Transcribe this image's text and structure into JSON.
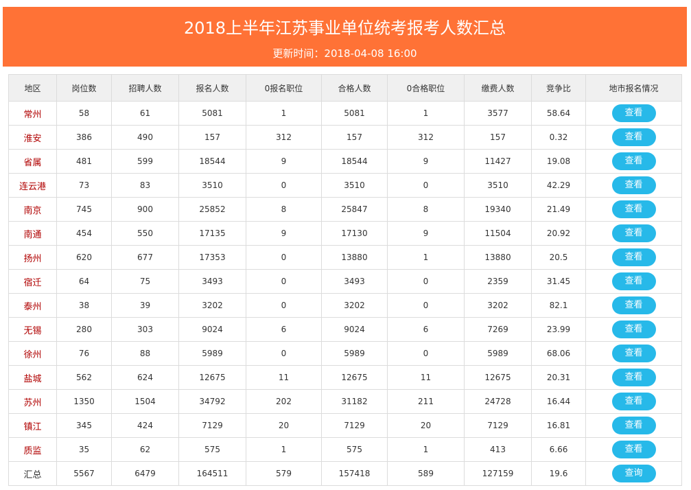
{
  "header": {
    "title": "2018上半年江苏事业单位统考报考人数汇总",
    "subtitle": "更新时间：2018-04-08 16:00"
  },
  "table": {
    "columns": [
      "地区",
      "岗位数",
      "招聘人数",
      "报名人数",
      "0报名职位",
      "合格人数",
      "0合格职位",
      "缴费人数",
      "竞争比",
      "地市报名情况"
    ],
    "rows": [
      {
        "region": "常州",
        "posts": "58",
        "hires": "61",
        "applicants": "5081",
        "zero_apply": "1",
        "qualified": "5081",
        "zero_qualified": "1",
        "paid": "3577",
        "ratio": "58.64",
        "action": "查看"
      },
      {
        "region": "淮安",
        "posts": "386",
        "hires": "490",
        "applicants": "157",
        "zero_apply": "312",
        "qualified": "157",
        "zero_qualified": "312",
        "paid": "157",
        "ratio": "0.32",
        "action": "查看"
      },
      {
        "region": "省属",
        "posts": "481",
        "hires": "599",
        "applicants": "18544",
        "zero_apply": "9",
        "qualified": "18544",
        "zero_qualified": "9",
        "paid": "11427",
        "ratio": "19.08",
        "action": "查看"
      },
      {
        "region": "连云港",
        "posts": "73",
        "hires": "83",
        "applicants": "3510",
        "zero_apply": "0",
        "qualified": "3510",
        "zero_qualified": "0",
        "paid": "3510",
        "ratio": "42.29",
        "action": "查看"
      },
      {
        "region": "南京",
        "posts": "745",
        "hires": "900",
        "applicants": "25852",
        "zero_apply": "8",
        "qualified": "25847",
        "zero_qualified": "8",
        "paid": "19340",
        "ratio": "21.49",
        "action": "查看"
      },
      {
        "region": "南通",
        "posts": "454",
        "hires": "550",
        "applicants": "17135",
        "zero_apply": "9",
        "qualified": "17130",
        "zero_qualified": "9",
        "paid": "11504",
        "ratio": "20.92",
        "action": "查看"
      },
      {
        "region": "扬州",
        "posts": "620",
        "hires": "677",
        "applicants": "17353",
        "zero_apply": "0",
        "qualified": "13880",
        "zero_qualified": "1",
        "paid": "13880",
        "ratio": "20.5",
        "action": "查看"
      },
      {
        "region": "宿迁",
        "posts": "64",
        "hires": "75",
        "applicants": "3493",
        "zero_apply": "0",
        "qualified": "3493",
        "zero_qualified": "0",
        "paid": "2359",
        "ratio": "31.45",
        "action": "查看"
      },
      {
        "region": "泰州",
        "posts": "38",
        "hires": "39",
        "applicants": "3202",
        "zero_apply": "0",
        "qualified": "3202",
        "zero_qualified": "0",
        "paid": "3202",
        "ratio": "82.1",
        "action": "查看"
      },
      {
        "region": "无锡",
        "posts": "280",
        "hires": "303",
        "applicants": "9024",
        "zero_apply": "6",
        "qualified": "9024",
        "zero_qualified": "6",
        "paid": "7269",
        "ratio": "23.99",
        "action": "查看"
      },
      {
        "region": "徐州",
        "posts": "76",
        "hires": "88",
        "applicants": "5989",
        "zero_apply": "0",
        "qualified": "5989",
        "zero_qualified": "0",
        "paid": "5989",
        "ratio": "68.06",
        "action": "查看"
      },
      {
        "region": "盐城",
        "posts": "562",
        "hires": "624",
        "applicants": "12675",
        "zero_apply": "11",
        "qualified": "12675",
        "zero_qualified": "11",
        "paid": "12675",
        "ratio": "20.31",
        "action": "查看"
      },
      {
        "region": "苏州",
        "posts": "1350",
        "hires": "1504",
        "applicants": "34792",
        "zero_apply": "202",
        "qualified": "31182",
        "zero_qualified": "211",
        "paid": "24728",
        "ratio": "16.44",
        "action": "查看"
      },
      {
        "region": "镇江",
        "posts": "345",
        "hires": "424",
        "applicants": "7129",
        "zero_apply": "20",
        "qualified": "7129",
        "zero_qualified": "20",
        "paid": "7129",
        "ratio": "16.81",
        "action": "查看"
      },
      {
        "region": "质监",
        "posts": "35",
        "hires": "62",
        "applicants": "575",
        "zero_apply": "1",
        "qualified": "575",
        "zero_qualified": "1",
        "paid": "413",
        "ratio": "6.66",
        "action": "查看"
      },
      {
        "region": "汇总",
        "posts": "5567",
        "hires": "6479",
        "applicants": "164511",
        "zero_apply": "579",
        "qualified": "157418",
        "zero_qualified": "589",
        "paid": "127159",
        "ratio": "19.6",
        "action": "查询",
        "is_total": true
      }
    ]
  },
  "colors": {
    "header_bg": "#ff7236",
    "button_bg": "#27b9e9",
    "region_text": "#b00000"
  }
}
